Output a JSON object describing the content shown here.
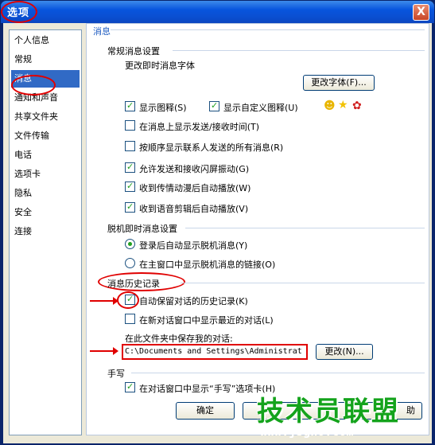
{
  "window": {
    "title": "选项",
    "close_label": "X"
  },
  "sidebar": {
    "items": [
      "个人信息",
      "常规",
      "消息",
      "通知和声音",
      "共享文件夹",
      "文件传输",
      "电话",
      "选项卡",
      "隐私",
      "安全",
      "连接"
    ],
    "selected_index": 2
  },
  "panel": {
    "title": "消息",
    "general": {
      "heading": "常规消息设置",
      "font_label": "更改即时消息字体",
      "font_button": "更改字体(F)...",
      "show_icons": {
        "label": "显示图释(S)",
        "checked": true
      },
      "show_custom_icons": {
        "label": "显示自定义图释(U)",
        "checked": true
      },
      "show_time": {
        "label": "在消息上显示发送/接收时间(T)",
        "checked": false
      },
      "show_all_messages": {
        "label": "按顺序显示联系人发送的所有消息(R)",
        "checked": false
      },
      "allow_nudge": {
        "label": "允许发送和接收闪屏振动(G)",
        "checked": true
      },
      "autoplay_wink": {
        "label": "收到传情动漫后自动播放(W)",
        "checked": true
      },
      "autoplay_voice": {
        "label": "收到语音剪辑后自动播放(V)",
        "checked": true
      }
    },
    "offline": {
      "heading": "脱机即时消息设置",
      "show_after_login": {
        "label": "登录后自动显示脱机消息(Y)",
        "checked": true
      },
      "show_link": {
        "label": "在主窗口中显示脱机消息的链接(O)",
        "checked": false
      }
    },
    "history": {
      "heading": "消息历史记录",
      "auto_save": {
        "label": "自动保留对话的历史记录(K)",
        "checked": true
      },
      "show_recent": {
        "label": "在新对话窗口中显示最近的对话(L)",
        "checked": false
      },
      "folder_label": "在此文件夹中保存我的对话:",
      "folder_value": "C:\\Documents and Settings\\Administrat",
      "change_button": "更改(N)..."
    },
    "handwriting": {
      "heading": "手写",
      "show_tab": {
        "label": "在对话窗口中显示“手写”选项卡(H)",
        "checked": true
      }
    }
  },
  "footer": {
    "ok_button": "确定",
    "partial_button": "助"
  },
  "watermark": {
    "title": "技术员联盟",
    "url": "www.jsgho.com"
  }
}
